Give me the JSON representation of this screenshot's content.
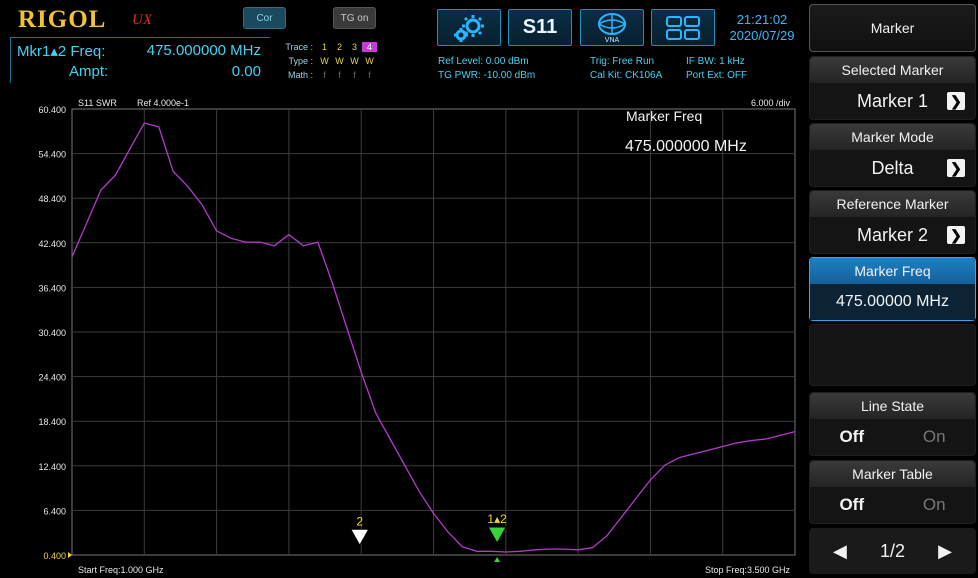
{
  "header": {
    "logo": "RIGOL",
    "logo_sub": "UX",
    "cor_label": "Cor",
    "tg_label": "TG on",
    "s11_label": "S11",
    "vna_label": "VNA",
    "time": "21:21:02",
    "date": "2020/07/29"
  },
  "marker_readout": {
    "freq_label": "Mkr1▴2 Freq:",
    "freq_value": "475.000000 MHz",
    "ampt_label": "Ampt:",
    "ampt_value": "0.00"
  },
  "traces": {
    "trace_label": "Trace :",
    "type_label": "Type :",
    "math_label": "Math :",
    "numbers": [
      "1",
      "2",
      "3",
      "4"
    ],
    "types": [
      "W",
      "W",
      "W",
      "W"
    ],
    "math": [
      "f",
      "f",
      "f",
      "f"
    ]
  },
  "info": {
    "ref_level": "Ref Level: 0.00 dBm",
    "tg_pwr": "TG PWR: -10.00 dBm",
    "trig": "Trig: Free Run",
    "cal_kit": "Cal Kit: CK106A",
    "if_bw": "IF BW: 1 kHz",
    "port_ext": "Port Ext: OFF"
  },
  "graph": {
    "mode_label": "S11  SWR",
    "ref_label": "Ref 4.000e-1",
    "div_label": "6.000  /div",
    "marker_freq_title": "Marker Freq",
    "marker_freq_value": "475.000000 MHz",
    "start_freq": "Start Freq:1.000 GHz",
    "stop_freq": "Stop Freq:3.500 GHz",
    "y_ticks": [
      "60.400",
      "54.400",
      "48.400",
      "42.400",
      "36.400",
      "30.400",
      "24.400",
      "18.400",
      "12.400",
      "6.400",
      "0.400"
    ],
    "marker2_label": "2",
    "marker12_label": "1▴2",
    "trace_color": "#b23cc8"
  },
  "menu": {
    "title": "Marker",
    "selected_marker": {
      "label": "Selected Marker",
      "value": "Marker 1"
    },
    "marker_mode": {
      "label": "Marker Mode",
      "value": "Delta"
    },
    "reference_marker": {
      "label": "Reference Marker",
      "value": "Marker 2"
    },
    "marker_freq": {
      "label": "Marker Freq",
      "value": "475.00000 MHz"
    },
    "line_state": {
      "label": "Line State",
      "off": "Off",
      "on": "On"
    },
    "marker_table": {
      "label": "Marker Table",
      "off": "Off",
      "on": "On"
    },
    "page": "1/2"
  },
  "chart_data": {
    "type": "line",
    "xlabel": "",
    "ylabel": "",
    "x_unit": "GHz",
    "xlim": [
      1.0,
      3.5
    ],
    "ylim": [
      0.4,
      60.4
    ],
    "grid": true,
    "series": [
      {
        "x": [
          1.0,
          1.05,
          1.1,
          1.15,
          1.2,
          1.25,
          1.3,
          1.35,
          1.4,
          1.45,
          1.5,
          1.55,
          1.6,
          1.65,
          1.7,
          1.75,
          1.8,
          1.85,
          1.9,
          1.95,
          2.0,
          2.05,
          2.1,
          2.15,
          2.2,
          2.25,
          2.3,
          2.35,
          2.4,
          2.45,
          2.5,
          2.55,
          2.6,
          2.65,
          2.7,
          2.75,
          2.8,
          2.85,
          2.9,
          2.95,
          3.0,
          3.05,
          3.1,
          3.15,
          3.2,
          3.25,
          3.3,
          3.35,
          3.4,
          3.45,
          3.5
        ],
        "values": [
          40.5,
          45.0,
          49.5,
          51.5,
          55.0,
          58.5,
          58.0,
          52.0,
          50.0,
          47.5,
          44.0,
          43.0,
          42.5,
          42.5,
          42.0,
          43.5,
          42.0,
          42.5,
          37.0,
          31.0,
          25.0,
          19.5,
          16.0,
          12.5,
          9.0,
          6.0,
          3.5,
          1.5,
          0.9,
          0.9,
          0.8,
          0.9,
          1.1,
          1.2,
          1.2,
          1.1,
          1.4,
          3.0,
          5.5,
          8.0,
          10.5,
          12.5,
          13.5,
          14.0,
          14.5,
          15.0,
          15.5,
          15.8,
          16.0,
          16.5,
          17.0
        ]
      }
    ],
    "markers": [
      {
        "label": "2",
        "x": 1.995,
        "y": 0.9
      },
      {
        "label": "1▴2",
        "x": 2.47,
        "y": 1.2
      }
    ]
  }
}
